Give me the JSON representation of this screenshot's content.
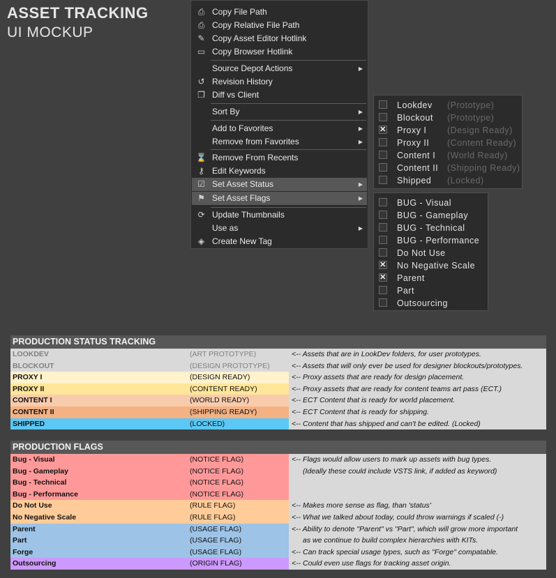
{
  "header": {
    "title": "ASSET TRACKING",
    "subtitle": "UI MOCKUP"
  },
  "context_menu": {
    "items": [
      {
        "label": "Copy File Path",
        "icon": "file-path-icon"
      },
      {
        "label": "Copy Relative File Path",
        "icon": "relative-path-icon"
      },
      {
        "label": "Copy Asset Editor Hotlink",
        "icon": "editor-hotlink-icon"
      },
      {
        "label": "Copy Browser Hotlink",
        "icon": "browser-hotlink-icon"
      },
      {
        "label": "Source Depot Actions",
        "submenu": true
      },
      {
        "label": "Revision History",
        "icon": "history-icon"
      },
      {
        "label": "Diff vs Client",
        "icon": "diff-icon"
      },
      {
        "label": "Sort By",
        "submenu": true
      },
      {
        "label": "Add to Favorites",
        "submenu": true
      },
      {
        "label": "Remove from Favorites",
        "submenu": true
      },
      {
        "label": "Remove From Recents",
        "icon": "remove-recent-icon"
      },
      {
        "label": "Edit Keywords",
        "icon": "key-icon"
      },
      {
        "label": "Set Asset Status",
        "icon": "checklist-icon",
        "submenu": true,
        "highlighted": true
      },
      {
        "label": "Set Asset Flags",
        "icon": "flag-icon",
        "submenu": true,
        "highlighted": true
      },
      {
        "label": "Update Thumbnails",
        "icon": "refresh-icon"
      },
      {
        "label": "Use as",
        "submenu": true
      },
      {
        "label": "Create New Tag",
        "icon": "tag-icon"
      }
    ]
  },
  "status_submenu": {
    "items": [
      {
        "name": "Lookdev",
        "status": "(Prototype)",
        "checked": false
      },
      {
        "name": "Blockout",
        "status": "(Prototype)",
        "checked": false
      },
      {
        "name": "Proxy I",
        "status": "(Design Ready)",
        "checked": true
      },
      {
        "name": "Proxy II",
        "status": "(Content Ready)",
        "checked": false
      },
      {
        "name": "Content I",
        "status": "(World Ready)",
        "checked": false
      },
      {
        "name": "Content II",
        "status": "(Shipping Ready)",
        "checked": false
      },
      {
        "name": "Shipped",
        "status": "(Locked)",
        "checked": false
      }
    ]
  },
  "flags_submenu": {
    "items": [
      {
        "name": "BUG - Visual",
        "checked": false
      },
      {
        "name": "BUG - Gameplay",
        "checked": false
      },
      {
        "name": "BUG - Technical",
        "checked": false
      },
      {
        "name": "BUG - Performance",
        "checked": false
      },
      {
        "name": "Do Not Use",
        "checked": false
      },
      {
        "name": "No Negative Scale",
        "checked": true
      },
      {
        "name": "Parent",
        "checked": true
      },
      {
        "name": "Part",
        "checked": false
      },
      {
        "name": "Outsourcing",
        "checked": false
      }
    ]
  },
  "status_table": {
    "title": "PRODUCTION STATUS TRACKING",
    "rows": [
      {
        "name": "LOOKDEV",
        "tag": "(ART PROTOTYPE)",
        "note": "<-- Assets that are in LookDev folders, for user prototypes.",
        "bg": "#d9d9d9",
        "fg": "#808080"
      },
      {
        "name": "BLOCKOUT",
        "tag": "(DESIGN PROTOTYPE)",
        "note": "<-- Assets that will only ever be used for designer blockouts/prototypes.",
        "bg": "#d9d9d9",
        "fg": "#808080"
      },
      {
        "name": "PROXY I",
        "tag": "(DESIGN READY)",
        "note": "<-- Proxy assets that are ready for design placement.",
        "bg": "#fff2cc",
        "fg": "#111111"
      },
      {
        "name": "PROXY II",
        "tag": "(CONTENT READY)",
        "note": "<-- Proxy assets that are ready for content teams art pass (ECT.)",
        "bg": "#ffe699",
        "fg": "#111111"
      },
      {
        "name": "CONTENT I",
        "tag": "(WORLD READY)",
        "note": "<-- ECT Content that is ready for world placement.",
        "bg": "#f8cbad",
        "fg": "#111111"
      },
      {
        "name": "CONTENT II",
        "tag": "(SHIPPING READY)",
        "note": "<-- ECT Content that is ready for shipping.",
        "bg": "#f4b183",
        "fg": "#111111"
      },
      {
        "name": "SHIPPED",
        "tag": "(LOCKED)",
        "note": "<-- Content that has shipped and can't be edited. (Locked)",
        "bg": "#5bc8f5",
        "fg": "#111111"
      }
    ]
  },
  "flags_table": {
    "title": "PRODUCTION FLAGS",
    "rows": [
      {
        "name": "Bug - Visual",
        "tag": "(NOTICE FLAG)",
        "note": "<-- Flags would allow users to mark up assets with bug types.",
        "bg": "#ff9999",
        "indent": false
      },
      {
        "name": "Bug - Gameplay",
        "tag": "(NOTICE FLAG)",
        "note": "(Ideally these could include VSTS link, if added as keyword)",
        "bg": "#ff9999",
        "indent": true
      },
      {
        "name": "Bug - Technical",
        "tag": "(NOTICE FLAG)",
        "note": "",
        "bg": "#ff9999",
        "indent": false
      },
      {
        "name": "Bug - Performance",
        "tag": "(NOTICE FLAG)",
        "note": "",
        "bg": "#ff9999",
        "indent": false
      },
      {
        "name": "Do Not Use",
        "tag": "(RULE FLAG)",
        "note": "<-- Makes more sense as flag, than 'status'",
        "bg": "#ffcc99",
        "indent": false
      },
      {
        "name": "No Negative Scale",
        "tag": "(RULE FLAG)",
        "note": "<-- What we talked about today, could throw warnings if scaled (-)",
        "bg": "#ffcc99",
        "indent": false
      },
      {
        "name": "Parent",
        "tag": "(USAGE FLAG)",
        "note": "<-- Ability to denote \"Parent\" vs \"Part\", which will grow more important",
        "bg": "#9dc3e6",
        "indent": false
      },
      {
        "name": "Part",
        "tag": "(USAGE FLAG)",
        "note": "as we continue to build complex hierarchies with KITs.",
        "bg": "#9dc3e6",
        "indent": true
      },
      {
        "name": "Forge",
        "tag": "(USAGE FLAG)",
        "note": "<-- Can track special usage types, such as \"Forge\" compatable.",
        "bg": "#9dc3e6",
        "indent": false
      },
      {
        "name": "Outsourcing",
        "tag": "(ORIGIN FLAG)",
        "note": "<-- Could even use flags for tracking asset origin.",
        "bg": "#cc99ff",
        "indent": false
      }
    ]
  }
}
